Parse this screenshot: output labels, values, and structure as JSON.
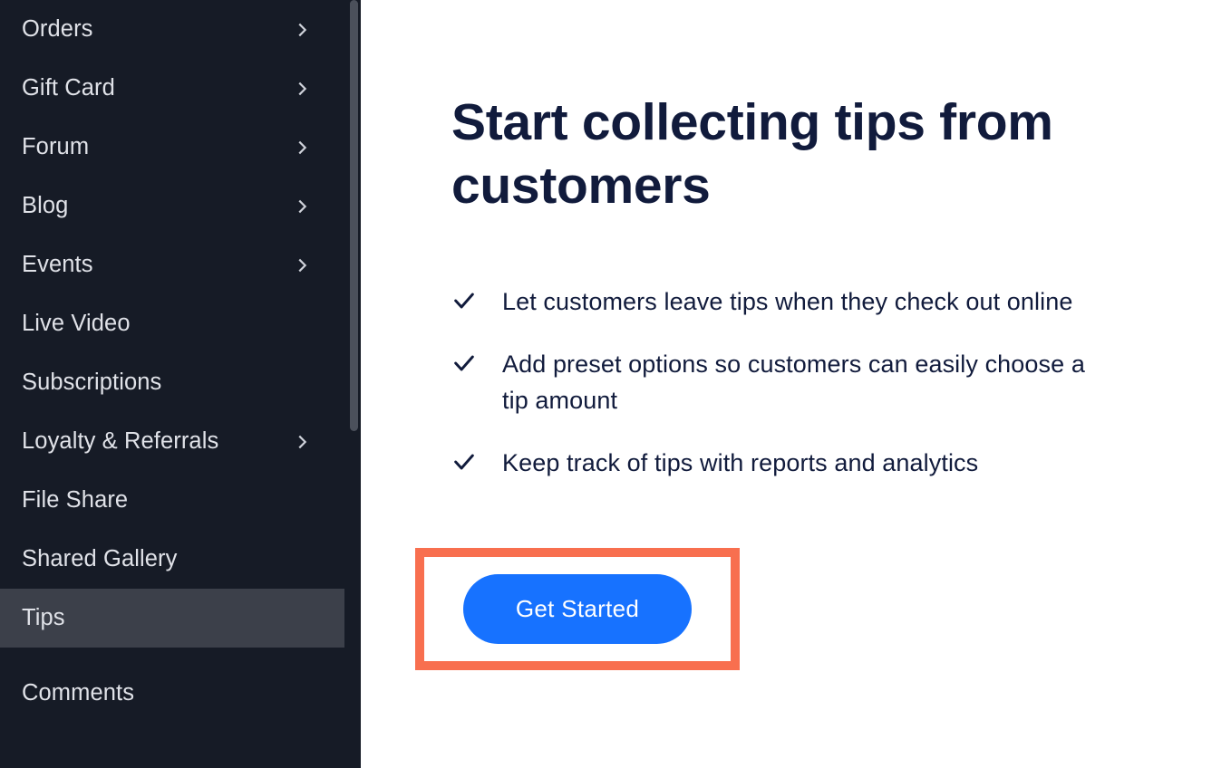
{
  "sidebar": {
    "items": [
      {
        "label": "Orders",
        "expandable": true,
        "active": false
      },
      {
        "label": "Gift Card",
        "expandable": true,
        "active": false
      },
      {
        "label": "Forum",
        "expandable": true,
        "active": false
      },
      {
        "label": "Blog",
        "expandable": true,
        "active": false
      },
      {
        "label": "Events",
        "expandable": true,
        "active": false
      },
      {
        "label": "Live Video",
        "expandable": false,
        "active": false
      },
      {
        "label": "Subscriptions",
        "expandable": false,
        "active": false
      },
      {
        "label": "Loyalty & Referrals",
        "expandable": true,
        "active": false
      },
      {
        "label": "File Share",
        "expandable": false,
        "active": false
      },
      {
        "label": "Shared Gallery",
        "expandable": false,
        "active": false
      },
      {
        "label": "Tips",
        "expandable": false,
        "active": true
      }
    ],
    "secondary": [
      {
        "label": "Comments",
        "expandable": false,
        "active": false
      }
    ]
  },
  "main": {
    "headline": "Start collecting tips from customers",
    "bullets": [
      "Let customers leave tips when they check out online",
      "Add preset options so customers can easily choose a tip amount",
      "Keep track of tips with reports and analytics"
    ],
    "cta_label": "Get Started"
  },
  "colors": {
    "accent": "#1772ff",
    "highlight_border": "#f86f4f",
    "sidebar_bg": "#161b26",
    "text_dark": "#111b3c"
  }
}
